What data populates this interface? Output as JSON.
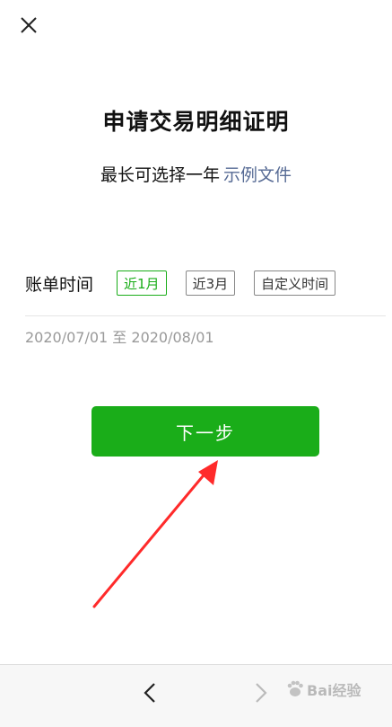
{
  "header": {
    "close_icon": "close-icon"
  },
  "main": {
    "title": "申请交易明细证明",
    "subtitle": "最长可选择一年",
    "sample_link": "示例文件",
    "period_label": "账单时间",
    "period_options": [
      "近1月",
      "近3月",
      "自定义时间"
    ],
    "selected_period": "近1月",
    "date_range": "2020/07/01 至 2020/08/01",
    "next_button": "下一步"
  },
  "bottom_nav": {
    "back_icon": "chevron-left-icon",
    "forward_icon": "chevron-right-icon"
  },
  "watermark": {
    "text": "Bai经验"
  },
  "colors": {
    "accent": "#1aad19",
    "link": "#576b95",
    "annotation_arrow": "#ff2a2a"
  }
}
